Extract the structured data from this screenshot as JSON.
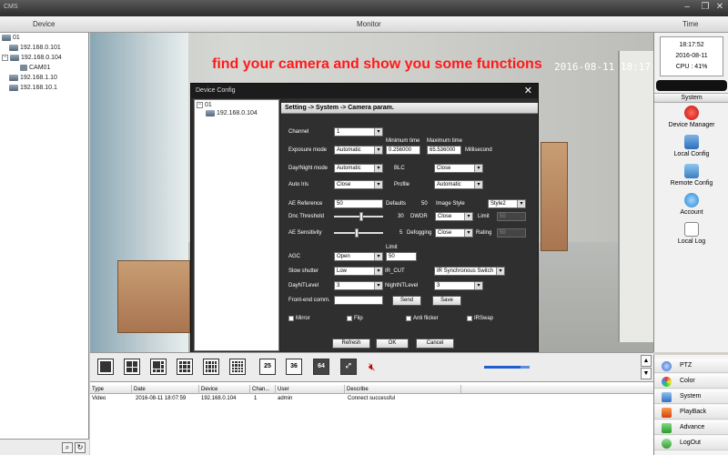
{
  "window": {
    "title": "CMS"
  },
  "header": {
    "device": "Device",
    "monitor": "Monitor",
    "time": "Time"
  },
  "tree": {
    "root": "01",
    "nodes": [
      "192.168.0.101",
      "192.168.0.104",
      "CAM01",
      "192.168.1.10",
      "192.168.10.1"
    ]
  },
  "video": {
    "banner": "find your camera and show you some functions",
    "osd": "2016-08-11  18:17:51"
  },
  "clock": {
    "time": "18:17:52",
    "date": "2016-08-11",
    "cpu": "CPU : 41%"
  },
  "right_panel": {
    "section": "System",
    "items": [
      "Device Manager",
      "Local Config",
      "Remote Config",
      "Account",
      "Local Log"
    ]
  },
  "dialog": {
    "title": "Device Config",
    "tree_root": "01",
    "tree_child": "192.168.0.104",
    "breadcrumb": "Setting -> System -> Camera param.",
    "channel_label": "Channel",
    "channel_value": "1",
    "min_time_label": "Minimum time",
    "max_time_label": "Maximum time",
    "exposure_label": "Exposure mode",
    "exposure_value": "Automatic",
    "min_time_value": "0.256000",
    "max_time_value": "65.536000",
    "ms_label": "Millisecond",
    "daynight_label": "Day/Night mode",
    "daynight_value": "Automatic",
    "blc_label": "BLC",
    "blc_value": "Close",
    "autoiris_label": "Auto Iris",
    "autoiris_value": "Close",
    "profile_label": "Profile",
    "profile_value": "Automatic",
    "aeref_label": "AE Reference",
    "aeref_value": "50",
    "defaults_label": "Defaults",
    "defaults_value": "50",
    "imgstyle_label": "Image Style",
    "imgstyle_value": "Style2",
    "dnc_label": "Dnc Threshold",
    "dnc_value": "30",
    "dwdr_label": "DWDR",
    "dwdr_value": "Close",
    "limit_label": "Limit",
    "limit_value": "50",
    "aesens_label": "AE Sensitivity",
    "aesens_value": "5",
    "defog_label": "Defogging",
    "defog_value": "Close",
    "rating_label": "Rating",
    "rating_value": "50",
    "agc_limit_label": "Limit",
    "agc_label": "AGC",
    "agc_value": "Open",
    "agc_limit_value": "50",
    "slow_label": "Slow shutter",
    "slow_value": "Low",
    "ircut_label": "IR_CUT",
    "ircut_value": "IR Synchronous Switch",
    "dayntl_label": "DayNTLevel",
    "dayntl_value": "3",
    "nightntl_label": "NightNTLevel",
    "nightntl_value": "3",
    "frontend_label": "Front-end comm.",
    "frontend_value": "",
    "send_label": "Send",
    "save_label": "Save",
    "mirror_label": "Mirror",
    "flip_label": "Flip",
    "antiflicker_label": "Anti flicker",
    "irswap_label": "IRSwap",
    "refresh_label": "Refresh",
    "ok_label": "OK",
    "cancel_label": "Cancel",
    "dnc_slider": 0.55,
    "aesens_slider": 0.45
  },
  "toolbar": {
    "b25": "25",
    "b36": "36",
    "b64": "64",
    "volume": 0.8
  },
  "log": {
    "columns": [
      "Type",
      "Date",
      "Device",
      "Chan...",
      "User",
      "Describe"
    ],
    "rows": [
      [
        "Video",
        "2016-08-11 18:07:59",
        "192.168.0.104",
        "1",
        "admin",
        "Connect successful"
      ]
    ]
  },
  "menu": {
    "items": [
      "PTZ",
      "Color",
      "System",
      "PlayBack",
      "Advance",
      "LogOut"
    ]
  }
}
